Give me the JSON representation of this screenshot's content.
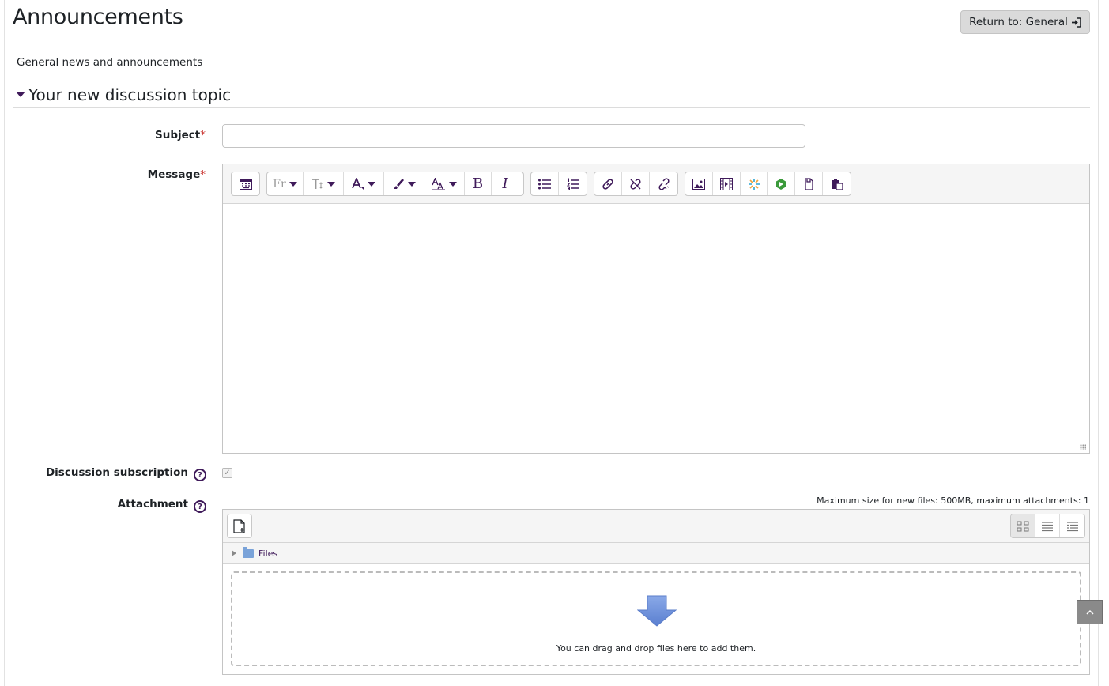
{
  "header": {
    "title": "Announcements",
    "return_button": "Return to: General"
  },
  "forum": {
    "intro": "General news and announcements"
  },
  "section": {
    "title": "Your new discussion topic"
  },
  "form": {
    "subject_label": "Subject",
    "message_label": "Message",
    "required_marker": "*",
    "subscription_label": "Discussion subscription",
    "subscription_checked": true,
    "attachment_label": "Attachment",
    "subject_value": ""
  },
  "editor": {
    "toolbar": {
      "font_family_abbrev": "Fr",
      "bold": "B",
      "italic": "I"
    }
  },
  "attachments": {
    "max_size_note": "Maximum size for new files: 500MB, maximum attachments: 1",
    "folder_label": "Files",
    "drop_text": "You can drag and drop files here to add them."
  },
  "colors": {
    "accent": "#3f1a5a",
    "required": "#c9302c",
    "drop_arrow": "#6b8ed6"
  }
}
